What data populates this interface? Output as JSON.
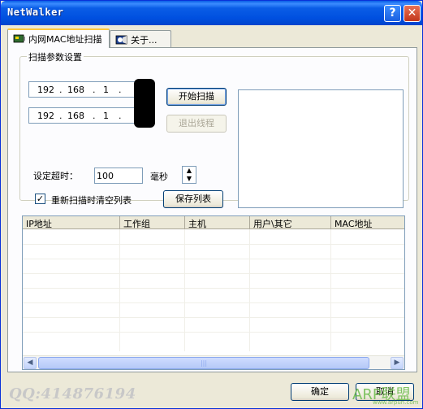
{
  "window": {
    "title": "NetWalker",
    "help_label": "?",
    "close_label": "✕"
  },
  "tabs": [
    {
      "label": "内网MAC地址扫描",
      "icon": "network-card-icon",
      "active": true
    },
    {
      "label": "关于...",
      "icon": "about-icon",
      "active": false
    }
  ],
  "scan_group": {
    "label": "扫描参数设置",
    "start_ip": [
      "192",
      "168",
      "1",
      ""
    ],
    "end_ip": [
      "192",
      "168",
      "1",
      ""
    ],
    "dot": ".",
    "start_button": "开始扫描",
    "exit_button": "退出线程",
    "timeout_label": "设定超时：",
    "timeout_value": "100",
    "timeout_unit": "毫秒",
    "clear_label": "重新扫描时清空列表",
    "clear_checked": true,
    "save_button": "保存列表"
  },
  "table": {
    "columns": [
      "IP地址",
      "工作组",
      "主机",
      "用户\\其它",
      "MAC地址"
    ],
    "rows": [],
    "scroll_grip": "|||"
  },
  "footer": {
    "watermark": "QQ:414876194",
    "ok_button": "确定",
    "cancel_button": "取消",
    "logo_text": "ARP联盟",
    "logo_url": "www.arpun.com"
  },
  "colors": {
    "titlebar": "#0a5de6",
    "face": "#ece9d8",
    "tab_highlight": "#ffc83c"
  }
}
